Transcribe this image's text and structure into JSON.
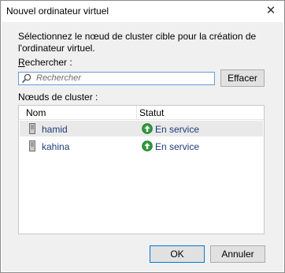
{
  "window": {
    "title": "Nouvel ordinateur virtuel",
    "close_glyph": "✕"
  },
  "description": "Sélectionnez le nœud de cluster cible pour la création de l'ordinateur virtuel.",
  "search": {
    "label_accel": "R",
    "label_rest": "echercher :",
    "placeholder": "Rechercher",
    "value": "",
    "clear_label": "Effacer",
    "icon": "search-icon"
  },
  "nodes": {
    "label": "Nœuds de cluster :",
    "columns": [
      "Nom",
      "Statut"
    ],
    "rows": [
      {
        "name": "hamid",
        "status": "En service",
        "selected": true,
        "icon": "server-icon",
        "status_icon": "up-arrow-status-icon"
      },
      {
        "name": "kahina",
        "status": "En service",
        "selected": false,
        "icon": "server-icon",
        "status_icon": "up-arrow-status-icon"
      }
    ]
  },
  "buttons": {
    "ok": "OK",
    "cancel": "Annuler"
  },
  "colors": {
    "status_green": "#2e9d3c",
    "link_text": "#1e3c78",
    "selection_bg": "#e9e9e9",
    "focus_border": "#0078d7"
  }
}
